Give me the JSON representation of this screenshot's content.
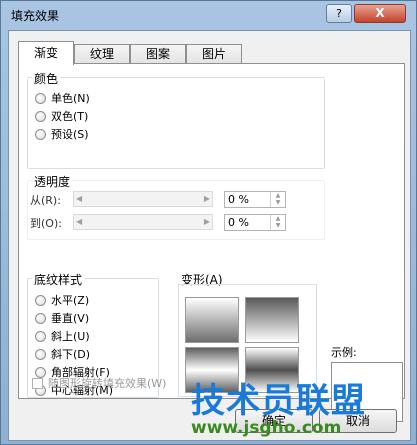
{
  "window": {
    "title": "填充效果",
    "help_label": "?",
    "close_label": "X"
  },
  "tabs": [
    {
      "label": "渐变",
      "active": true
    },
    {
      "label": "纹理",
      "active": false
    },
    {
      "label": "图案",
      "active": false
    },
    {
      "label": "图片",
      "active": false
    }
  ],
  "colors_group": {
    "label": "颜色",
    "options": [
      "单色(N)",
      "双色(T)",
      "预设(S)"
    ]
  },
  "transparency_group": {
    "label": "透明度",
    "from_label": "从(R):",
    "to_label": "到(O):",
    "from_value": "0 %",
    "to_value": "0 %"
  },
  "shading_group": {
    "label": "底纹样式",
    "options": [
      "水平(Z)",
      "垂直(V)",
      "斜上(U)",
      "斜下(D)",
      "角部辐射(F)",
      "中心辐射(M)"
    ]
  },
  "variants_group": {
    "label": "变形(A)"
  },
  "sample": {
    "label": "示例:"
  },
  "rotate_checkbox": {
    "label": "随图形旋转填充效果(W)"
  },
  "buttons": {
    "ok": "确定",
    "cancel": "取消"
  },
  "watermark": {
    "title": "技术员联盟",
    "url": "www.jsgho.com"
  }
}
